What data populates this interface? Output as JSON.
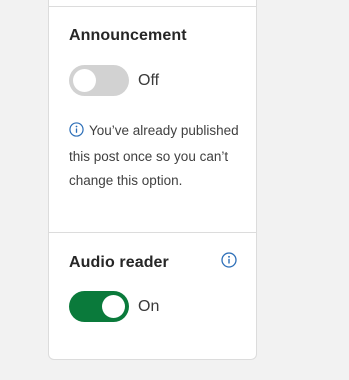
{
  "announcement": {
    "title": "Announcement",
    "toggle_state": "off",
    "toggle_label": "Off",
    "notice": "You’ve already published this post once so you can’t change this option."
  },
  "audio_reader": {
    "title": "Audio reader",
    "toggle_state": "on",
    "toggle_label": "On"
  },
  "icons": {
    "announcement_notice": "info-icon",
    "audio_reader_help": "info-icon"
  },
  "colors": {
    "page_background": "#f2f2f2",
    "panel_background": "#ffffff",
    "border": "#dcdcdc",
    "toggle_on": "#0a7a3b",
    "toggle_off": "#d2d2d2",
    "info_icon": "#2d6fb8"
  }
}
